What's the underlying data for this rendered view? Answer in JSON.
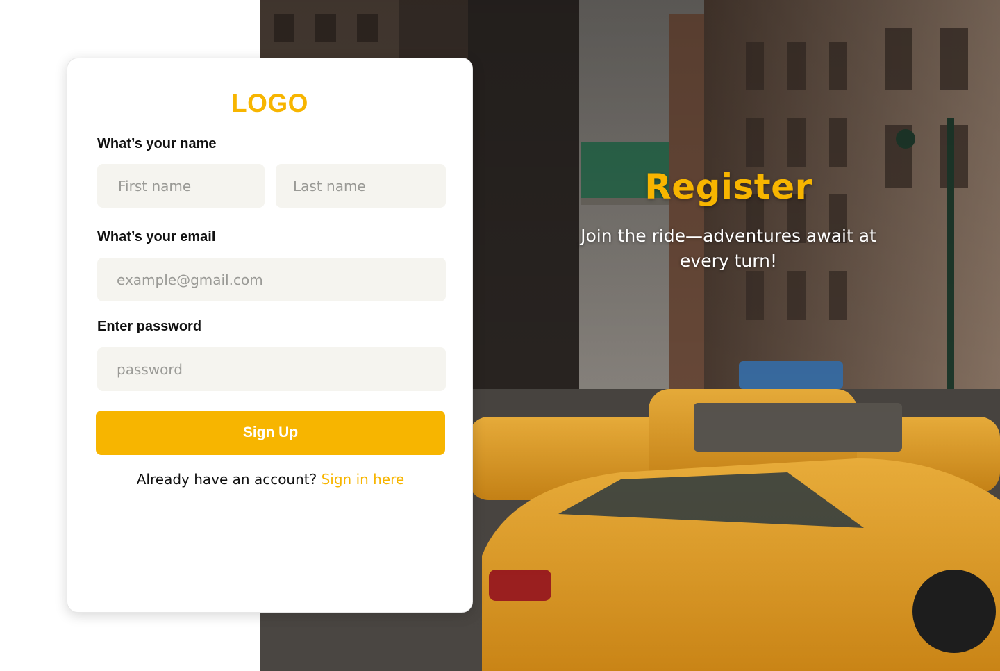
{
  "card": {
    "logo": "LOGO",
    "name_label": "What’s your name",
    "first_name_placeholder": "First name",
    "last_name_placeholder": "Last name",
    "email_label": "What’s your email",
    "email_placeholder": "example@gmail.com",
    "password_label": "Enter password",
    "password_placeholder": "password",
    "signup_button": "Sign Up",
    "signin_prompt": "Already have an account?",
    "signin_link": "Sign in here"
  },
  "hero": {
    "title": "Register",
    "subtitle": "Join the ride—adventures await at every turn!",
    "photo": "nyc-street-yellow-taxis-image"
  },
  "colors": {
    "accent": "#f7b500",
    "field_bg": "#f5f4ef",
    "text": "#111111"
  }
}
